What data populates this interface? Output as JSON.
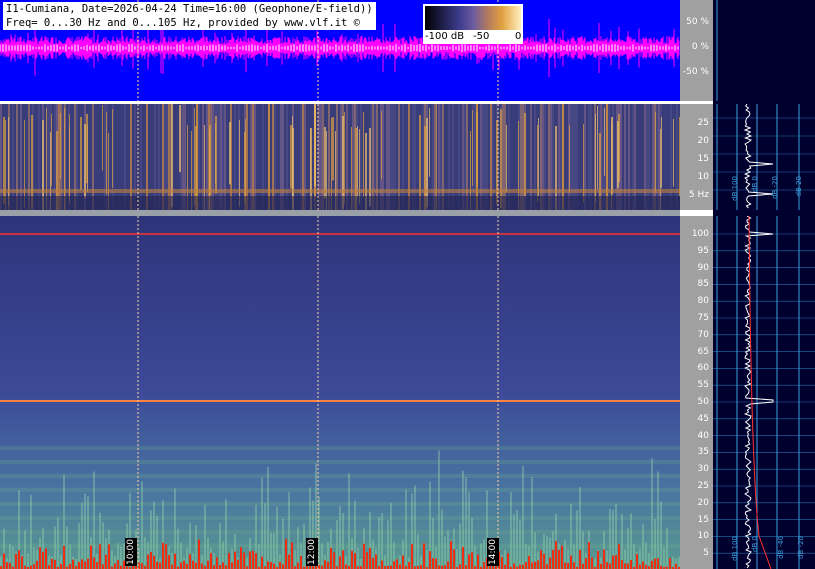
{
  "header": {
    "title_line": "I1-Cumiana, Date=2026-04-24 Time=16:00 (Geophone/E-field))",
    "freq_line": "Freq= 0...30 Hz and 0...105 Hz, provided by www.vlf.it ©"
  },
  "colorbar": {
    "labels": [
      "-100 dB",
      "-50",
      "0"
    ]
  },
  "waveform_axis": {
    "ticks": [
      "50 %",
      "0 %",
      "-50 %"
    ]
  },
  "low_spectrogram_axis": {
    "ticks": [
      "25",
      "20",
      "15",
      "10",
      "5 Hz"
    ]
  },
  "high_spectrogram_axis": {
    "ticks": [
      "100",
      "95",
      "90",
      "85",
      "80",
      "75",
      "70",
      "65",
      "60",
      "55",
      "50",
      "45",
      "40",
      "35",
      "30",
      "25",
      "20",
      "15",
      "10",
      "5"
    ]
  },
  "time_markers": [
    "10:00",
    "12:00",
    "14:00"
  ],
  "profile_labels": {
    "low": [
      "dB 100",
      "dB 0",
      "dB -20",
      "dB 20"
    ],
    "high": [
      "dB 100",
      "dB 0",
      "dB -40",
      "dB -20"
    ]
  },
  "colors": {
    "waveform_bg": "#0000ff",
    "waveform_trace": "#ff00ff",
    "axis_bg": "#a0a0a0",
    "profile_bg": "#00002e",
    "grid_line": "#3aa0e0",
    "hum_line": "#ff3030"
  }
}
